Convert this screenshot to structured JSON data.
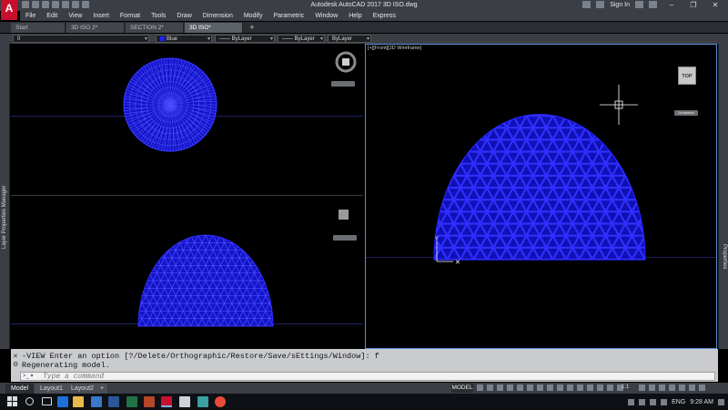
{
  "title_bar": {
    "app_logo": "A",
    "title": "Autodesk AutoCAD 2017    3D ISO.dwg",
    "sign_in": "Sign In"
  },
  "menu": [
    "File",
    "Edit",
    "View",
    "Insert",
    "Format",
    "Tools",
    "Draw",
    "Dimension",
    "Modify",
    "Parametric",
    "Window",
    "Help",
    "Express"
  ],
  "file_tabs": [
    {
      "label": "Start"
    },
    {
      "label": "3D ISO 2*"
    },
    {
      "label": "SECTION 2*"
    },
    {
      "label": "3D ISO*"
    }
  ],
  "properties": {
    "layer": "0",
    "color": "Blue",
    "linetype": "ByLayer",
    "lineweight": "ByLayer",
    "plotstyle": "ByLayer"
  },
  "side_panels": {
    "left": "Layer Properties Manager",
    "right": "Properties"
  },
  "viewports": {
    "right_label": "[+][Front][2D Wireframe]",
    "navcube_face": "TOP",
    "navcube_ucs": "Unnamed"
  },
  "command_line": {
    "history": [
      "-VIEW Enter an option [?/Delete/Orthographic/Restore/Save/sEttings/Window]: f",
      "Regenerating model."
    ],
    "placeholder": "Type a command"
  },
  "layout_tabs": [
    "Model",
    "Layout1",
    "Layout2"
  ],
  "status": {
    "model": "MODEL",
    "scale": "1:1"
  },
  "taskbar": {
    "language": "ENG",
    "time": "9:28 AM"
  },
  "colors": {
    "wireframe": "#1a1aff",
    "ucs_axis": "#ffffff",
    "accent_border": "#5a8fd6"
  }
}
